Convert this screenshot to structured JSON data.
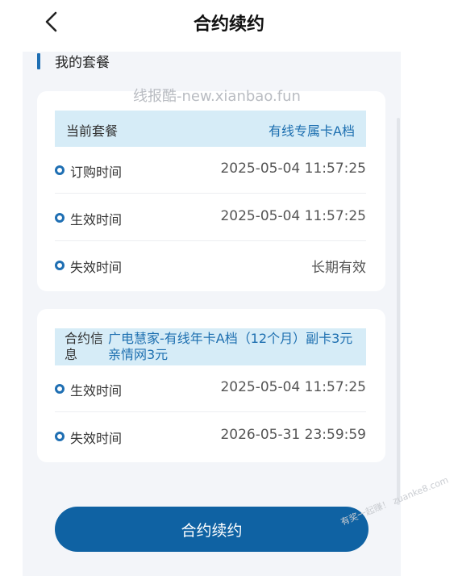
{
  "header": {
    "title": "合约续约",
    "back_icon": "chevron-left-icon"
  },
  "section": {
    "title": "我的套餐"
  },
  "watermark": "线报酷-new.xianbao.fun",
  "current_plan": {
    "label": "当前套餐",
    "value": "有线专属卡A档",
    "rows": [
      {
        "label": "订购时间",
        "value": "2025-05-04 11:57:25"
      },
      {
        "label": "生效时间",
        "value": "2025-05-04 11:57:25"
      },
      {
        "label": "失效时间",
        "value": "长期有效"
      }
    ]
  },
  "contract": {
    "label": "合约信息",
    "value": "广电慧家-有线年卡A档（12个月）副卡3元亲情网3元",
    "rows": [
      {
        "label": "生效时间",
        "value": "2025-05-04 11:57:25"
      },
      {
        "label": "失效时间",
        "value": "2026-05-31 23:59:59"
      }
    ]
  },
  "renew_button": {
    "label": "合约续约"
  },
  "corner_watermark": "有奖一起赚！ zuanke8.com",
  "colors": {
    "accent": "#0f62a3",
    "highlight_bg": "#d6ecf7",
    "panel_bg": "#f3f5f9"
  }
}
